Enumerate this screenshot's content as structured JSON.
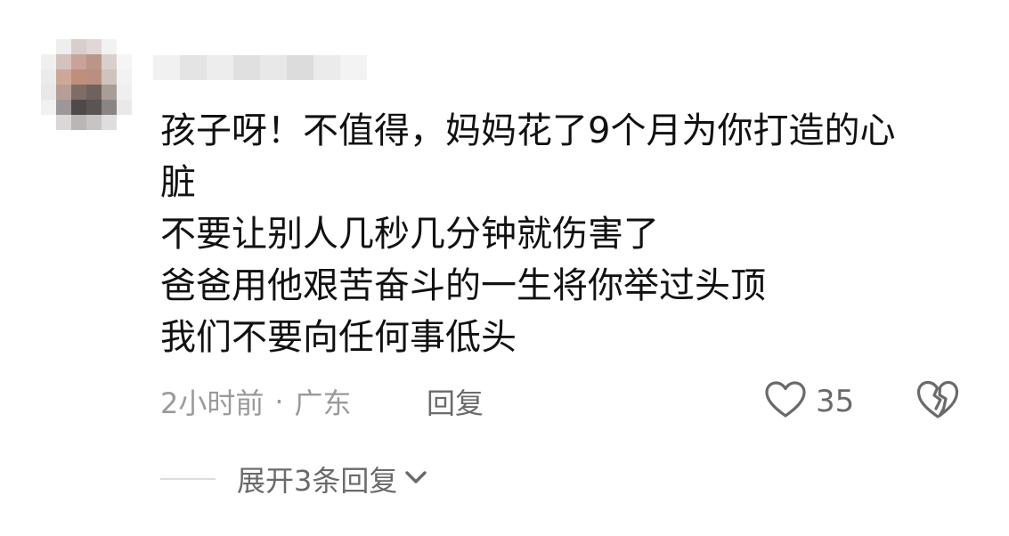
{
  "comment": {
    "lines": [
      "孩子呀！不值得，妈妈花了9个月为你打造的心",
      "脏",
      "不要让别人几秒几分钟就伤害了",
      "爸爸用他艰苦奋斗的一生将你举过头顶",
      "我们不要向任何事低头"
    ]
  },
  "meta": {
    "time": "2小时前",
    "separator": "·",
    "location": "广东",
    "reply_label": "回复"
  },
  "like": {
    "count": "35",
    "icon": "heart-outline-icon"
  },
  "dislike": {
    "icon": "broken-heart-icon"
  },
  "expand": {
    "label": "展开3条回复",
    "icon": "chevron-down-icon"
  },
  "colors": {
    "text": "#111111",
    "meta": "#9a9a9a",
    "action": "#6a6a6a",
    "divider": "#dcdcdc"
  }
}
